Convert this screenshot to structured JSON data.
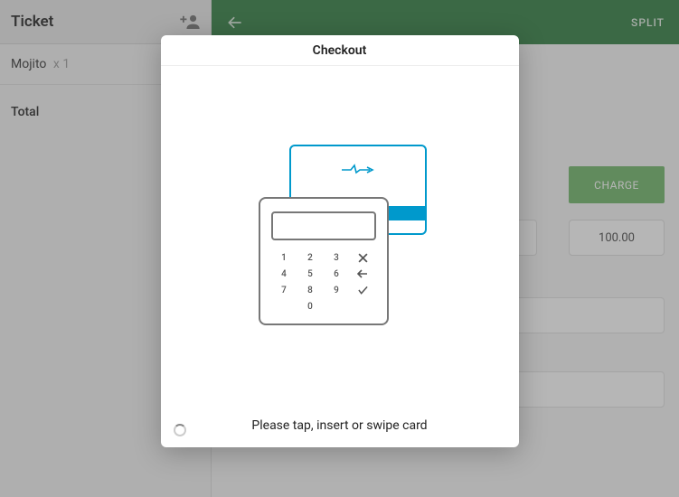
{
  "sidebar": {
    "title": "Ticket",
    "item_name": "Mojito",
    "item_qty": "x 1",
    "total_label": "Total"
  },
  "topbar": {
    "split": "SPLIT"
  },
  "main": {
    "charge": "CHARGE",
    "amount": "100.00"
  },
  "modal": {
    "title": "Checkout",
    "prompt": "Please tap, insert or swipe card",
    "keys": [
      "1",
      "2",
      "3",
      "",
      "4",
      "5",
      "6",
      "",
      "7",
      "8",
      "9",
      "",
      "",
      "0",
      "",
      ""
    ]
  }
}
